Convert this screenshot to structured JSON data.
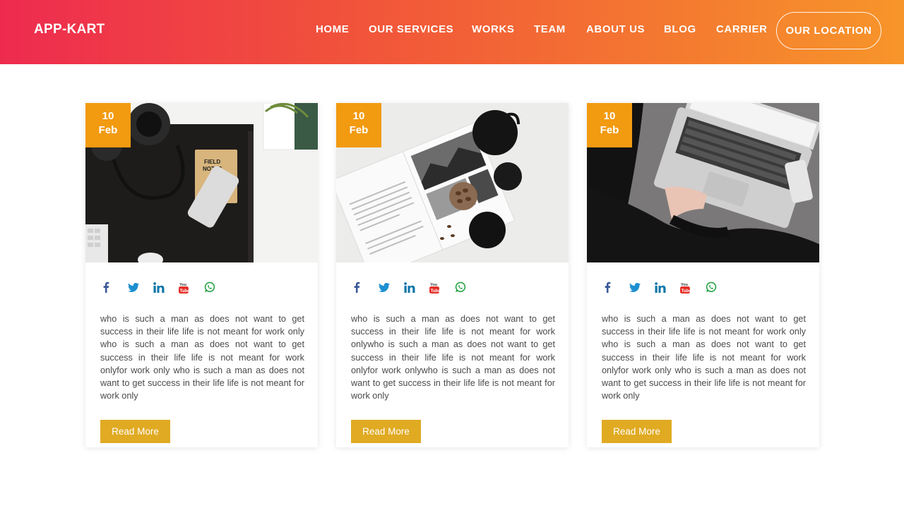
{
  "header": {
    "brand": "APP-KART",
    "nav": [
      "HOME",
      "OUR SERVICES",
      "WORKS",
      "TEAM",
      "ABOUT US",
      "BLOG",
      "CARRIER"
    ],
    "cta": "OUR LOCATION"
  },
  "cards": [
    {
      "day": "10",
      "month": "Feb",
      "text": "who is such a man as does not want to get success in their life life is not meant for work only who is such a man as does not want to get success in their life life is not meant for work onlyfor work only who is such a man as does not want to get success in their life life is not meant for work only",
      "button": "Read More",
      "image": "workspace-headphones-phone"
    },
    {
      "day": "10",
      "month": "Feb",
      "text": "who is such a man as does not want to get success in their life life is not meant for work onlywho is such a man as does not want to get success in their life life is not meant for work onlyfor work onlywho is such a man as does not want to get success in their life life is not meant for work only",
      "button": "Read More",
      "image": "open-book-teapot"
    },
    {
      "day": "10",
      "month": "Feb",
      "text": "who is such a man as does not want to get success in their life life is not meant for work only who is such a man as does not want to get success in their life life is not meant for work onlyfor work only who is such a man as does not want to get success in their life life is not meant for work only",
      "button": "Read More",
      "image": "laptop-on-lap"
    }
  ],
  "social_icons": [
    "facebook-icon",
    "twitter-icon",
    "linkedin-icon",
    "youtube-icon",
    "whatsapp-icon"
  ],
  "colors": {
    "gradient_start": "#ee2b4f",
    "gradient_end": "#f7952a",
    "date_badge": "#f29a10",
    "button": "#e0aa22",
    "facebook": "#3b5998",
    "twitter": "#1d8fd1",
    "linkedin": "#0e76a8",
    "youtube": "#e52d27",
    "whatsapp": "#25a244"
  }
}
